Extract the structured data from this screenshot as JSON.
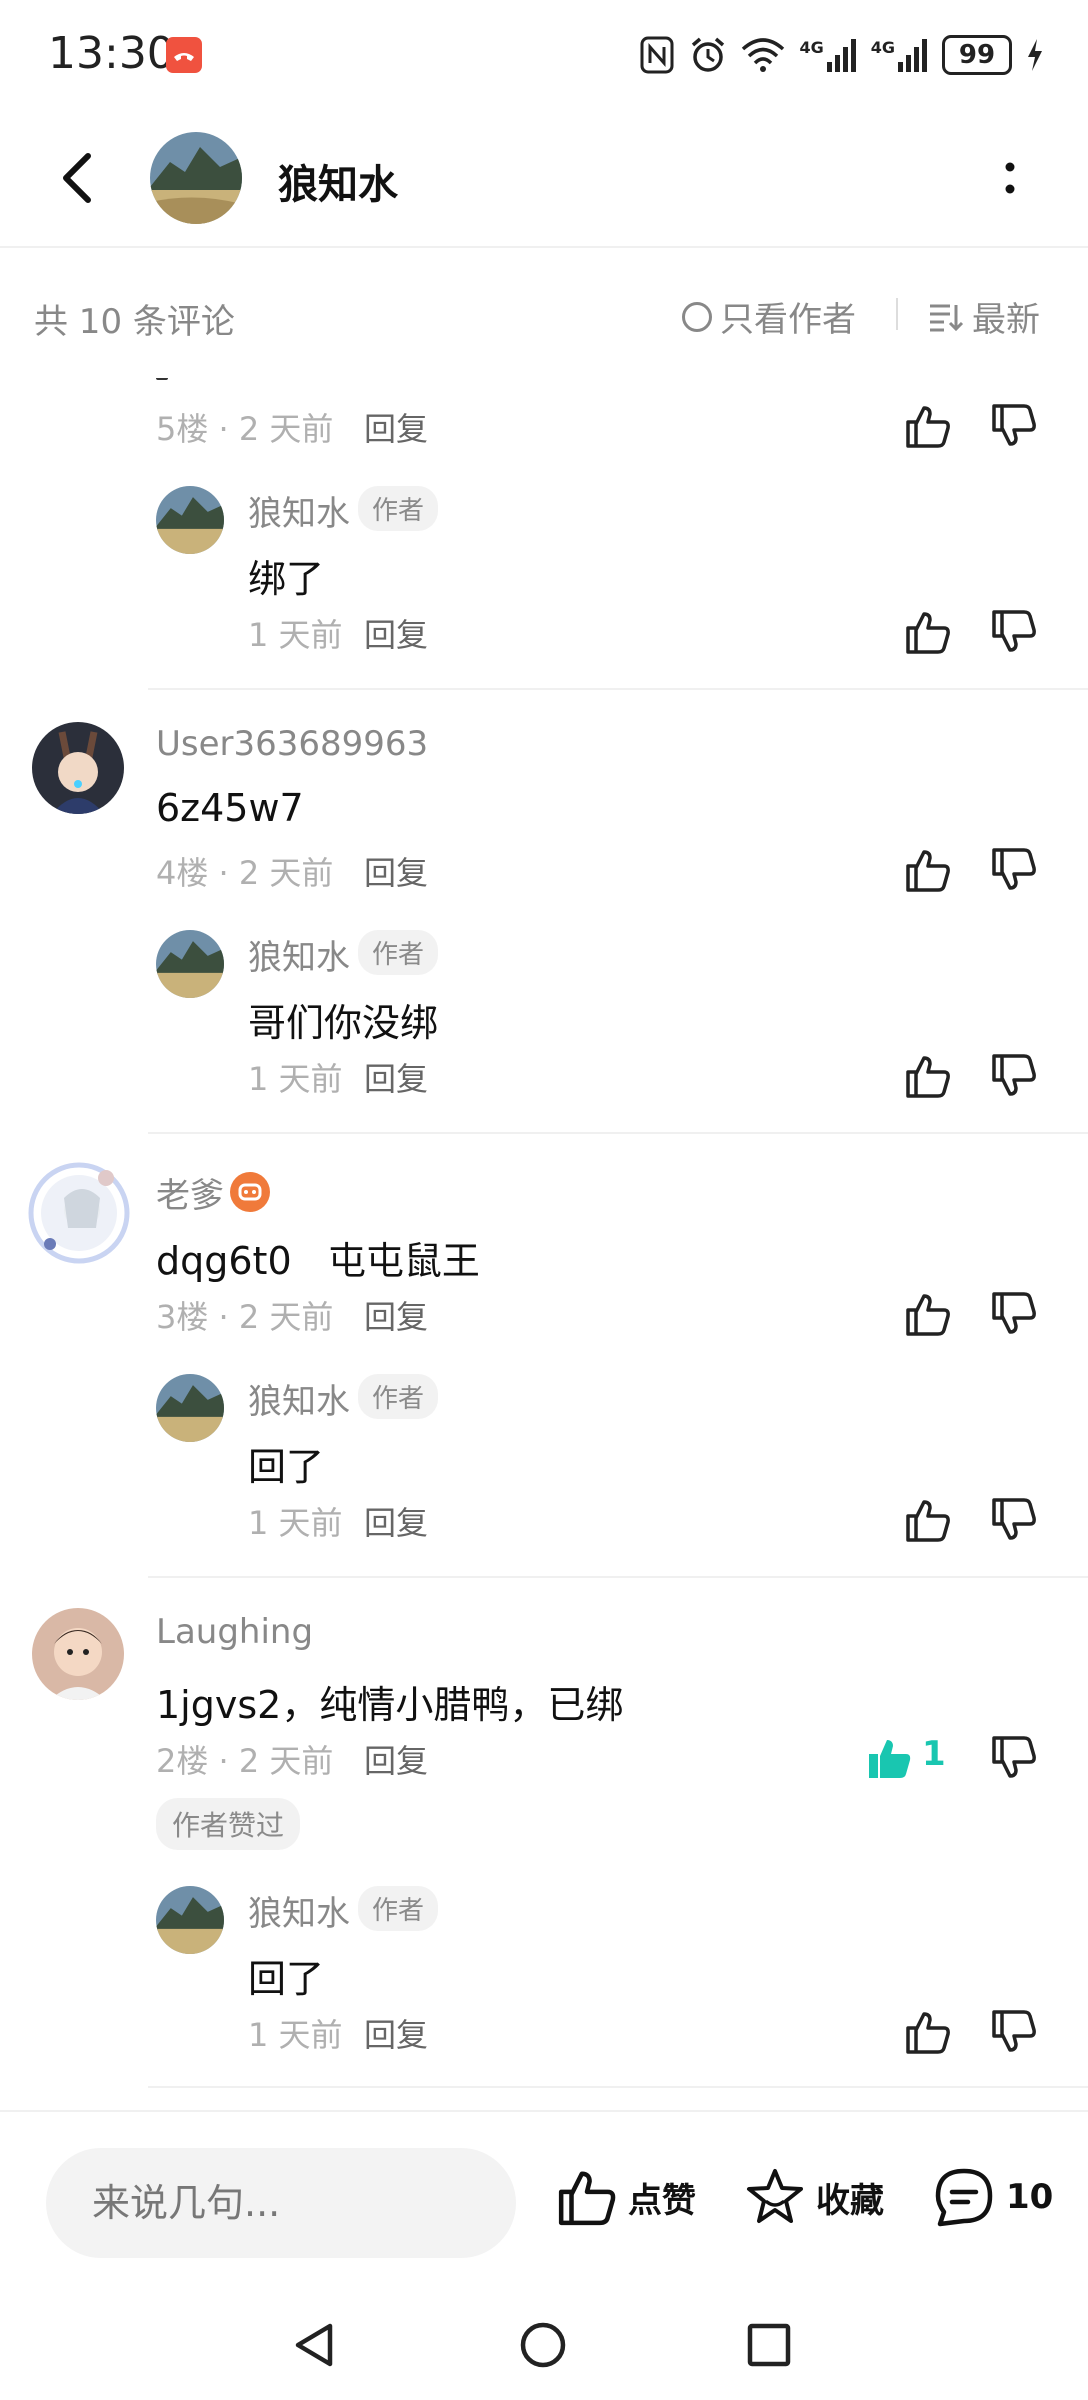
{
  "status_bar": {
    "time": "13:30",
    "network_1": "4G",
    "network_2": "4G",
    "battery": "99"
  },
  "header": {
    "title": "狼知水"
  },
  "filter_bar": {
    "count_label": "共 10 条评论",
    "author_only_label": "只看作者",
    "sort_label": "最新"
  },
  "comments": {
    "c5": {
      "floor_meta": "5楼 · 2 天前",
      "reply_label": "回复"
    },
    "c5_reply": {
      "name": "狼知水",
      "tag": "作者",
      "text": "绑了",
      "time": "1 天前",
      "reply_label": "回复"
    },
    "c4": {
      "name": "User363689963",
      "text": "6z45w7",
      "floor_meta": "4楼 · 2 天前",
      "reply_label": "回复"
    },
    "c4_reply": {
      "name": "狼知水",
      "tag": "作者",
      "text": "哥们你没绑",
      "time": "1 天前",
      "reply_label": "回复"
    },
    "c3": {
      "name": "老爹",
      "text": "dqg6t0   屯屯鼠王",
      "floor_meta": "3楼 · 2 天前",
      "reply_label": "回复"
    },
    "c3_reply": {
      "name": "狼知水",
      "tag": "作者",
      "text": "回了",
      "time": "1 天前",
      "reply_label": "回复"
    },
    "c2": {
      "name": "Laughing",
      "text": "1jgvs2，纯情小腊鸭，已绑",
      "floor_meta": "2楼 · 2 天前",
      "reply_label": "回复",
      "like_count": "1",
      "author_liked": "作者赞过"
    },
    "c2_reply": {
      "name": "狼知水",
      "tag": "作者",
      "text": "回了",
      "time": "1 天前",
      "reply_label": "回复"
    }
  },
  "bottom_bar": {
    "input_placeholder": "来说几句...",
    "like_label": "点赞",
    "favorite_label": "收藏",
    "comment_count": "10"
  },
  "colors": {
    "accent_like": "#19c6b0",
    "call_badge": "#f0523f",
    "vip_badge": "#f07a3a"
  },
  "icons": [
    "back-arrow-icon",
    "more-vertical-icon",
    "thumb-up-icon",
    "thumb-down-icon",
    "star-icon",
    "comment-bubble-icon",
    "nav-back-icon",
    "nav-home-icon",
    "nav-recents-icon"
  ]
}
